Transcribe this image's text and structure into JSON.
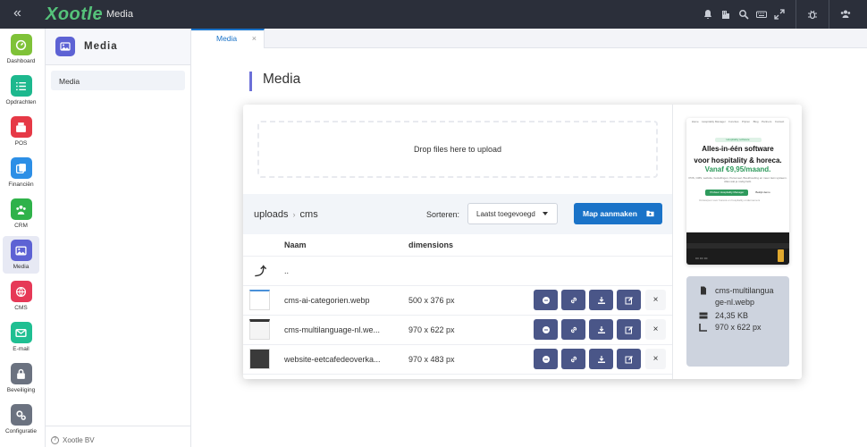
{
  "topbar": {
    "logo": "Xootle",
    "title": "Media",
    "icons": [
      "bell-icon",
      "building-icon",
      "search-icon",
      "keyboard-icon",
      "expand-icon",
      "bug-icon",
      "users-icon"
    ]
  },
  "rail": {
    "items": [
      {
        "label": "Dashboard",
        "icon": "dashboard-icon",
        "color": "#7fc238",
        "active": false
      },
      {
        "label": "Opdrachten",
        "icon": "tasks-icon",
        "color": "#1db88e",
        "active": false
      },
      {
        "label": "POS",
        "icon": "pos-icon",
        "color": "#e63946",
        "active": false
      },
      {
        "label": "Financiën",
        "icon": "finance-icon",
        "color": "#2d8fe6",
        "active": false
      },
      {
        "label": "CRM",
        "icon": "crm-icon",
        "color": "#2fb24a",
        "active": false
      },
      {
        "label": "Media",
        "icon": "media-icon",
        "color": "#5d62d4",
        "active": true
      },
      {
        "label": "CMS",
        "icon": "cms-icon",
        "color": "#e63957",
        "active": false
      },
      {
        "label": "E-mail",
        "icon": "email-icon",
        "color": "#1fbf92",
        "active": false
      },
      {
        "label": "Beveiliging",
        "icon": "lock-icon",
        "color": "#6b7280",
        "active": false
      },
      {
        "label": "Configuratie",
        "icon": "config-icon",
        "color": "#6b7280",
        "active": false
      }
    ]
  },
  "sidepanel": {
    "title": "Media",
    "items": [
      "Media"
    ],
    "footer": "Xootle BV"
  },
  "tabs": [
    {
      "label": "Media",
      "close": "×"
    }
  ],
  "page": {
    "title": "Media"
  },
  "upload": {
    "dropzone_text": "Drop files here to upload"
  },
  "toolbar": {
    "breadcrumb": [
      "uploads",
      "cms"
    ],
    "breadcrumb_sep": "›",
    "sort_label": "Sorteren:",
    "sort_value": "Laatst toegevoegd",
    "new_folder_label": "Map aanmaken"
  },
  "table": {
    "headers": {
      "name": "Naam",
      "dimensions": "dimensions"
    },
    "parent_row": {
      "icon": "⤴",
      "name": ".."
    },
    "rows": [
      {
        "name": "cms-ai-categorien.webp",
        "dimensions": "500 x 376 px"
      },
      {
        "name": "cms-multilanguage-nl.we...",
        "dimensions": "970 x 622 px"
      },
      {
        "name": "website-eetcafedeoverka...",
        "dimensions": "970 x 483 px"
      }
    ],
    "delete_glyph": "×"
  },
  "preview": {
    "nav": [
      "Home",
      "Hospitality Manager",
      "Functies",
      "Prijzen",
      "Blog",
      "Partners",
      "Contact"
    ],
    "badge": "Hospitality software",
    "headline_1": "Alles-in-één software",
    "headline_2": "voor hospitality & horeca.",
    "headline_3": "Vanaf €9,95/maand.",
    "body": "POS, CMS, website, bestellingen, Personeel, Boekhouding en meer. Eén systeem. Alles wat je nodig hebt.",
    "cta_primary": "Probeer Hospitality Manager",
    "cta_secondary": "Bekijk demo",
    "small": "Ontworpen voor horeca en hospitality ondernemers"
  },
  "file_info": {
    "filename": "cms-multilanguage-nl.webp",
    "size": "24,35 KB",
    "dimensions": "970 x 622 px"
  }
}
